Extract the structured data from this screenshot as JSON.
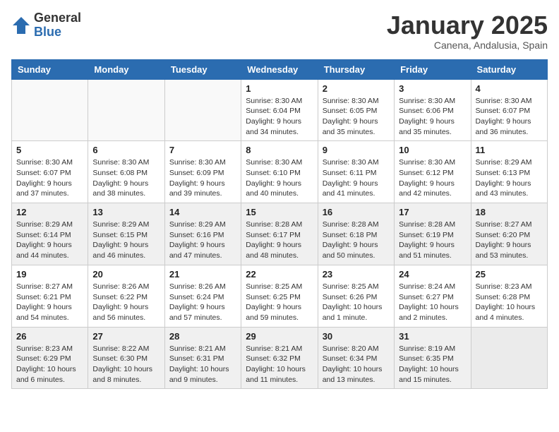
{
  "logo": {
    "general": "General",
    "blue": "Blue"
  },
  "title": "January 2025",
  "location": "Canena, Andalusia, Spain",
  "days_of_week": [
    "Sunday",
    "Monday",
    "Tuesday",
    "Wednesday",
    "Thursday",
    "Friday",
    "Saturday"
  ],
  "weeks": [
    {
      "shaded": false,
      "days": [
        {
          "num": "",
          "info": ""
        },
        {
          "num": "",
          "info": ""
        },
        {
          "num": "",
          "info": ""
        },
        {
          "num": "1",
          "info": "Sunrise: 8:30 AM\nSunset: 6:04 PM\nDaylight: 9 hours\nand 34 minutes."
        },
        {
          "num": "2",
          "info": "Sunrise: 8:30 AM\nSunset: 6:05 PM\nDaylight: 9 hours\nand 35 minutes."
        },
        {
          "num": "3",
          "info": "Sunrise: 8:30 AM\nSunset: 6:06 PM\nDaylight: 9 hours\nand 35 minutes."
        },
        {
          "num": "4",
          "info": "Sunrise: 8:30 AM\nSunset: 6:07 PM\nDaylight: 9 hours\nand 36 minutes."
        }
      ]
    },
    {
      "shaded": false,
      "days": [
        {
          "num": "5",
          "info": "Sunrise: 8:30 AM\nSunset: 6:07 PM\nDaylight: 9 hours\nand 37 minutes."
        },
        {
          "num": "6",
          "info": "Sunrise: 8:30 AM\nSunset: 6:08 PM\nDaylight: 9 hours\nand 38 minutes."
        },
        {
          "num": "7",
          "info": "Sunrise: 8:30 AM\nSunset: 6:09 PM\nDaylight: 9 hours\nand 39 minutes."
        },
        {
          "num": "8",
          "info": "Sunrise: 8:30 AM\nSunset: 6:10 PM\nDaylight: 9 hours\nand 40 minutes."
        },
        {
          "num": "9",
          "info": "Sunrise: 8:30 AM\nSunset: 6:11 PM\nDaylight: 9 hours\nand 41 minutes."
        },
        {
          "num": "10",
          "info": "Sunrise: 8:30 AM\nSunset: 6:12 PM\nDaylight: 9 hours\nand 42 minutes."
        },
        {
          "num": "11",
          "info": "Sunrise: 8:29 AM\nSunset: 6:13 PM\nDaylight: 9 hours\nand 43 minutes."
        }
      ]
    },
    {
      "shaded": true,
      "days": [
        {
          "num": "12",
          "info": "Sunrise: 8:29 AM\nSunset: 6:14 PM\nDaylight: 9 hours\nand 44 minutes."
        },
        {
          "num": "13",
          "info": "Sunrise: 8:29 AM\nSunset: 6:15 PM\nDaylight: 9 hours\nand 46 minutes."
        },
        {
          "num": "14",
          "info": "Sunrise: 8:29 AM\nSunset: 6:16 PM\nDaylight: 9 hours\nand 47 minutes."
        },
        {
          "num": "15",
          "info": "Sunrise: 8:28 AM\nSunset: 6:17 PM\nDaylight: 9 hours\nand 48 minutes."
        },
        {
          "num": "16",
          "info": "Sunrise: 8:28 AM\nSunset: 6:18 PM\nDaylight: 9 hours\nand 50 minutes."
        },
        {
          "num": "17",
          "info": "Sunrise: 8:28 AM\nSunset: 6:19 PM\nDaylight: 9 hours\nand 51 minutes."
        },
        {
          "num": "18",
          "info": "Sunrise: 8:27 AM\nSunset: 6:20 PM\nDaylight: 9 hours\nand 53 minutes."
        }
      ]
    },
    {
      "shaded": false,
      "days": [
        {
          "num": "19",
          "info": "Sunrise: 8:27 AM\nSunset: 6:21 PM\nDaylight: 9 hours\nand 54 minutes."
        },
        {
          "num": "20",
          "info": "Sunrise: 8:26 AM\nSunset: 6:22 PM\nDaylight: 9 hours\nand 56 minutes."
        },
        {
          "num": "21",
          "info": "Sunrise: 8:26 AM\nSunset: 6:24 PM\nDaylight: 9 hours\nand 57 minutes."
        },
        {
          "num": "22",
          "info": "Sunrise: 8:25 AM\nSunset: 6:25 PM\nDaylight: 9 hours\nand 59 minutes."
        },
        {
          "num": "23",
          "info": "Sunrise: 8:25 AM\nSunset: 6:26 PM\nDaylight: 10 hours\nand 1 minute."
        },
        {
          "num": "24",
          "info": "Sunrise: 8:24 AM\nSunset: 6:27 PM\nDaylight: 10 hours\nand 2 minutes."
        },
        {
          "num": "25",
          "info": "Sunrise: 8:23 AM\nSunset: 6:28 PM\nDaylight: 10 hours\nand 4 minutes."
        }
      ]
    },
    {
      "shaded": true,
      "days": [
        {
          "num": "26",
          "info": "Sunrise: 8:23 AM\nSunset: 6:29 PM\nDaylight: 10 hours\nand 6 minutes."
        },
        {
          "num": "27",
          "info": "Sunrise: 8:22 AM\nSunset: 6:30 PM\nDaylight: 10 hours\nand 8 minutes."
        },
        {
          "num": "28",
          "info": "Sunrise: 8:21 AM\nSunset: 6:31 PM\nDaylight: 10 hours\nand 9 minutes."
        },
        {
          "num": "29",
          "info": "Sunrise: 8:21 AM\nSunset: 6:32 PM\nDaylight: 10 hours\nand 11 minutes."
        },
        {
          "num": "30",
          "info": "Sunrise: 8:20 AM\nSunset: 6:34 PM\nDaylight: 10 hours\nand 13 minutes."
        },
        {
          "num": "31",
          "info": "Sunrise: 8:19 AM\nSunset: 6:35 PM\nDaylight: 10 hours\nand 15 minutes."
        },
        {
          "num": "",
          "info": ""
        }
      ]
    }
  ]
}
